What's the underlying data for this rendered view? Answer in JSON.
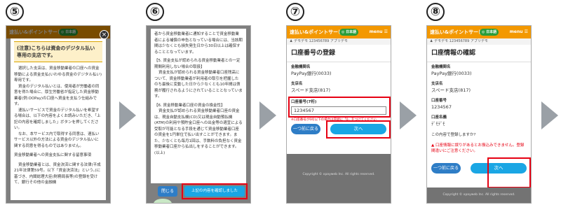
{
  "steps": [
    "⑤",
    "⑥",
    "⑦",
    "⑧"
  ],
  "header": {
    "app_title": "速払い&ポイントサービス",
    "lang_badge": "◎ 日本語",
    "menu_label": "menu ☰"
  },
  "subbar": {
    "user_text": "♟ デモデモ 123456789 アプリデモ"
  },
  "screen5": {
    "notice": "(注意)こちらは資金のデジタル払い専用の支店です。",
    "paragraphs": [
      "選択した支店は、資金移動業者の口座への資金移動による資金支払(いわゆる資金のデジタル払い)専用です。",
      "資金のデジタル払いとは、使用者が労働者の同意を得た場合に、厚生労働省が指定した資金移動業者(例:OOPay)の口座へ資金を支払う仕組みです。",
      "速払いサービスで資金のデジタル払いを希望する場合は、以下の内容をよくお読みいただき、「上記の内容を確認しました」ボタンを押してください。",
      "なお、本サービス内で取得する同意は、速払いサービス以外の方法による資金のデジタル払いに関する同意を得るものではありません。",
      "資金移動業者への資金支払に関する留意事項",
      "資金移動業者とは、資金決済に関する法律(平成21年法律第59号。以下「資金決済法」という。)に基づき、内閣総理大臣(財務局長等)の登録を受けて、銀行その他の金融機"
    ],
    "close_icon": "×"
  },
  "screen6": {
    "paragraphs": [
      "者から資金移動業者に通知することで資金移動業者による補償の申告となっている場合には、当該期間は少なくとも損失発生日から30日以上は確保することとなっています。",
      "【5. 資金支払が認められる資金移動業者との一定期間利用しない場合の取扱】",
      "資金支払が認められる資金移動業者口座残高について、資金移動業者が利用者の取引を把握したのち最後に変動した日から少なくとも10年間は債務が履行されるようにされていることとなっています。",
      "【6. 資金移動業者口座の資金の換金性】",
      "資金支払が認められる資金移動業者口座の資金は、現金自動支払機(CD)又は現金自動預払機(ATM)の利用や預貯金口座への出金等の適宜による受取が可能となる手段を通じて資金移動業者口座の資金を1円単位で払い出すことができます。また、少なくとも毎月1回は、手数料の負担なく資金移動業者口座から払出しをすることができます。",
      "(以上)"
    ],
    "close_label": "閉じる",
    "confirm_label": "上記の内容を確認しました"
  },
  "screen7": {
    "title": "口座番号の登録",
    "fields": [
      {
        "label": "金融機関名",
        "value": "PayPay銀行(0033)"
      },
      {
        "label": "支店名",
        "value": "スペード支店(817)"
      }
    ],
    "account_label": "口座番号(7桁)",
    "account_value": "1234567",
    "hint": "※口座番号が6桁以下の場合は冒頭に「0」をつけてください",
    "back_label": "一つ前に戻る",
    "next_label": "次へ",
    "footer": "Copyright © xpayweb Inc. All rights reserved."
  },
  "screen8": {
    "title": "口座情報の確認",
    "fields": [
      {
        "label": "金融機関名",
        "value": "PayPay銀行(0033)"
      },
      {
        "label": "支店名",
        "value": "スペード支店(817)"
      },
      {
        "label": "口座番号",
        "value": "1234567"
      },
      {
        "label": "口座名義",
        "value": "ﾃﾞﾓﾃﾞﾓ"
      }
    ],
    "question": "この内容で登録しますか?",
    "warning": "▲ 口座情報に誤りがあるとお振込みできません。登録間違いにご注意ください。",
    "back_label": "一つ前に戻る",
    "next_label": "次へ",
    "footer": "Copyright © xpayweb Inc. All rights reserved."
  },
  "colors": {
    "accent_orange": "#f39800",
    "button_blue": "#1aa6e4",
    "highlight_red": "#e60012"
  }
}
